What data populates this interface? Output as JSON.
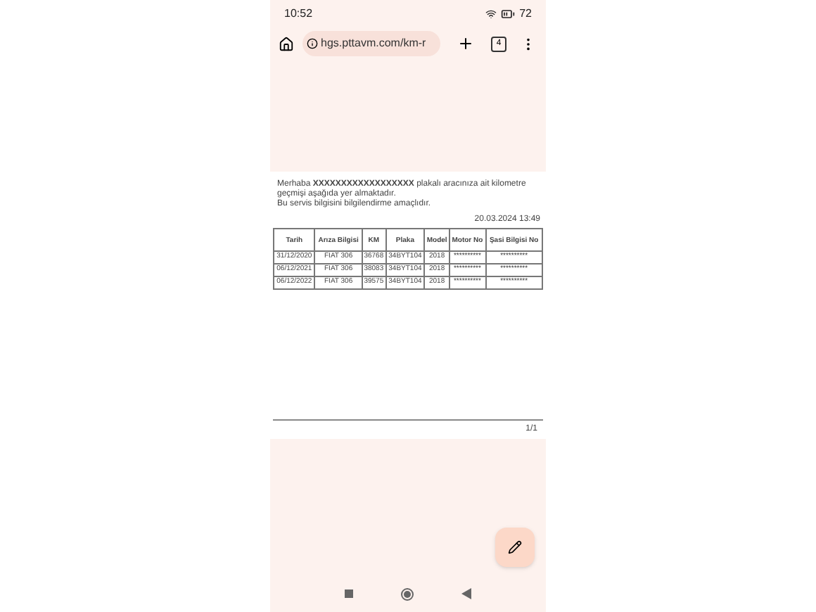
{
  "status_bar": {
    "time": "10:52",
    "battery": "72"
  },
  "browser": {
    "url": "hgs.pttavm.com/km-r",
    "tab_count": "4"
  },
  "document": {
    "intro": "Merhaba **XXXXXXXXXXXXXXXXXX** plakalı aracınıza ait kilometre geçmişi aşağıda yer almaktadır.",
    "note": "Bu servis bilgisini bilgilendirme amaçlıdır.",
    "date": "20.03.2024 13:49",
    "columns": [
      "Tarih",
      "Arıza Bilgisi",
      "KM",
      "Plaka",
      "Model",
      "Motor No",
      "Şasi Bilgisi No"
    ],
    "rows": [
      [
        "31/12/2020",
        "FIAT 306",
        "36768",
        "34BYT104",
        "2018",
        "**********",
        "**********"
      ],
      [
        "06/12/2021",
        "FIAT 306",
        "38083",
        "34BYT104",
        "2018",
        "**********",
        "**********"
      ],
      [
        "06/12/2022",
        "FIAT 306",
        "39575",
        "34BYT104",
        "2018",
        "**********",
        "**********"
      ]
    ],
    "page_number": "1/1"
  }
}
